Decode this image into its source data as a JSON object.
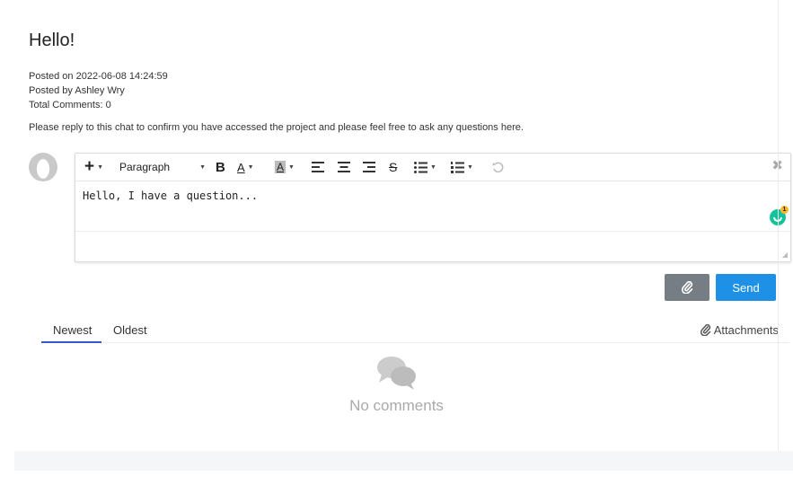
{
  "post": {
    "title": "Hello!",
    "posted_on": "Posted on 2022-06-08 14:24:59",
    "posted_by": "Posted by Ashley Wry",
    "total_comments": "Total Comments: 0",
    "description": "Please reply to this chat to confirm you have accessed the project and please feel free to ask any questions here."
  },
  "editor": {
    "format_select": "Paragraph",
    "content": "Hello, I have a question...",
    "grammarly_count": "1",
    "toolbar_icons": [
      "plus-icon",
      "bold-icon",
      "font-color-icon",
      "background-color-icon",
      "align-left-icon",
      "align-center-icon",
      "align-right-icon",
      "strikethrough-icon",
      "bullet-list-icon",
      "numbered-list-icon",
      "undo-icon",
      "close-icon"
    ]
  },
  "actions": {
    "send_label": "Send"
  },
  "tabs": {
    "newest": "Newest",
    "oldest": "Oldest",
    "active": "newest",
    "attachments": "Attachments"
  },
  "comments": {
    "empty_text": "No comments"
  },
  "colors": {
    "primary": "#1e90e6",
    "attach_button": "#777d85",
    "tab_underline": "#3a57c4",
    "grammarly": "#15c39a"
  }
}
